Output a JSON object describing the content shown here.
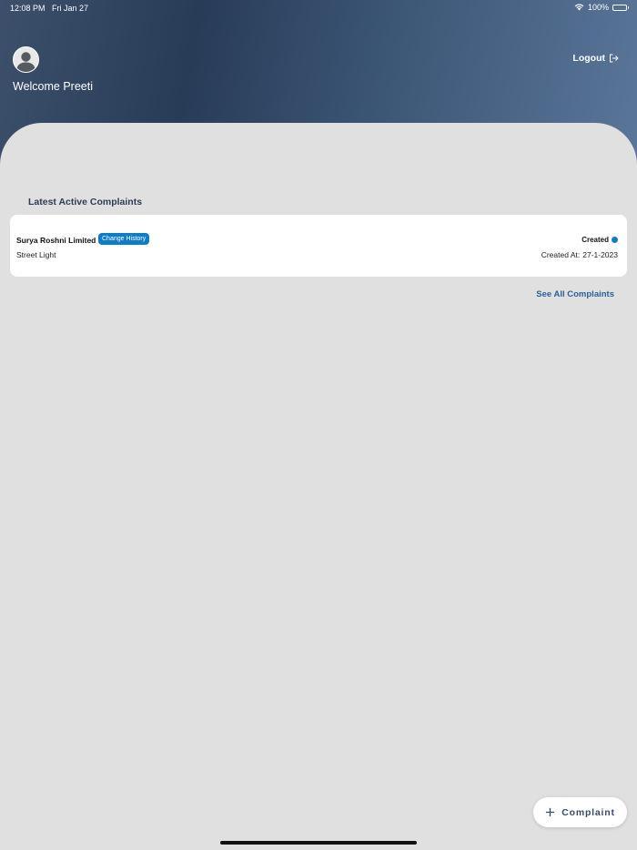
{
  "status_bar": {
    "time": "12:08 PM",
    "date": "Fri Jan 27",
    "battery": "100%"
  },
  "header": {
    "welcome": "Welcome Preeti",
    "logout_label": "Logout"
  },
  "section": {
    "title": "Latest Active Complaints"
  },
  "complaint": {
    "company": "Surya Roshni Limited",
    "history_label": "Change History",
    "category": "Street Light",
    "status": "Created",
    "created_at_label": "Created At:",
    "created_at_value": "27-1-2023"
  },
  "links": {
    "see_all": "See All Complaints"
  },
  "fab": {
    "label": "Complaint"
  },
  "colors": {
    "accent": "#0f7cc7",
    "header_dark": "#283c58",
    "background": "#e0e0e0"
  }
}
